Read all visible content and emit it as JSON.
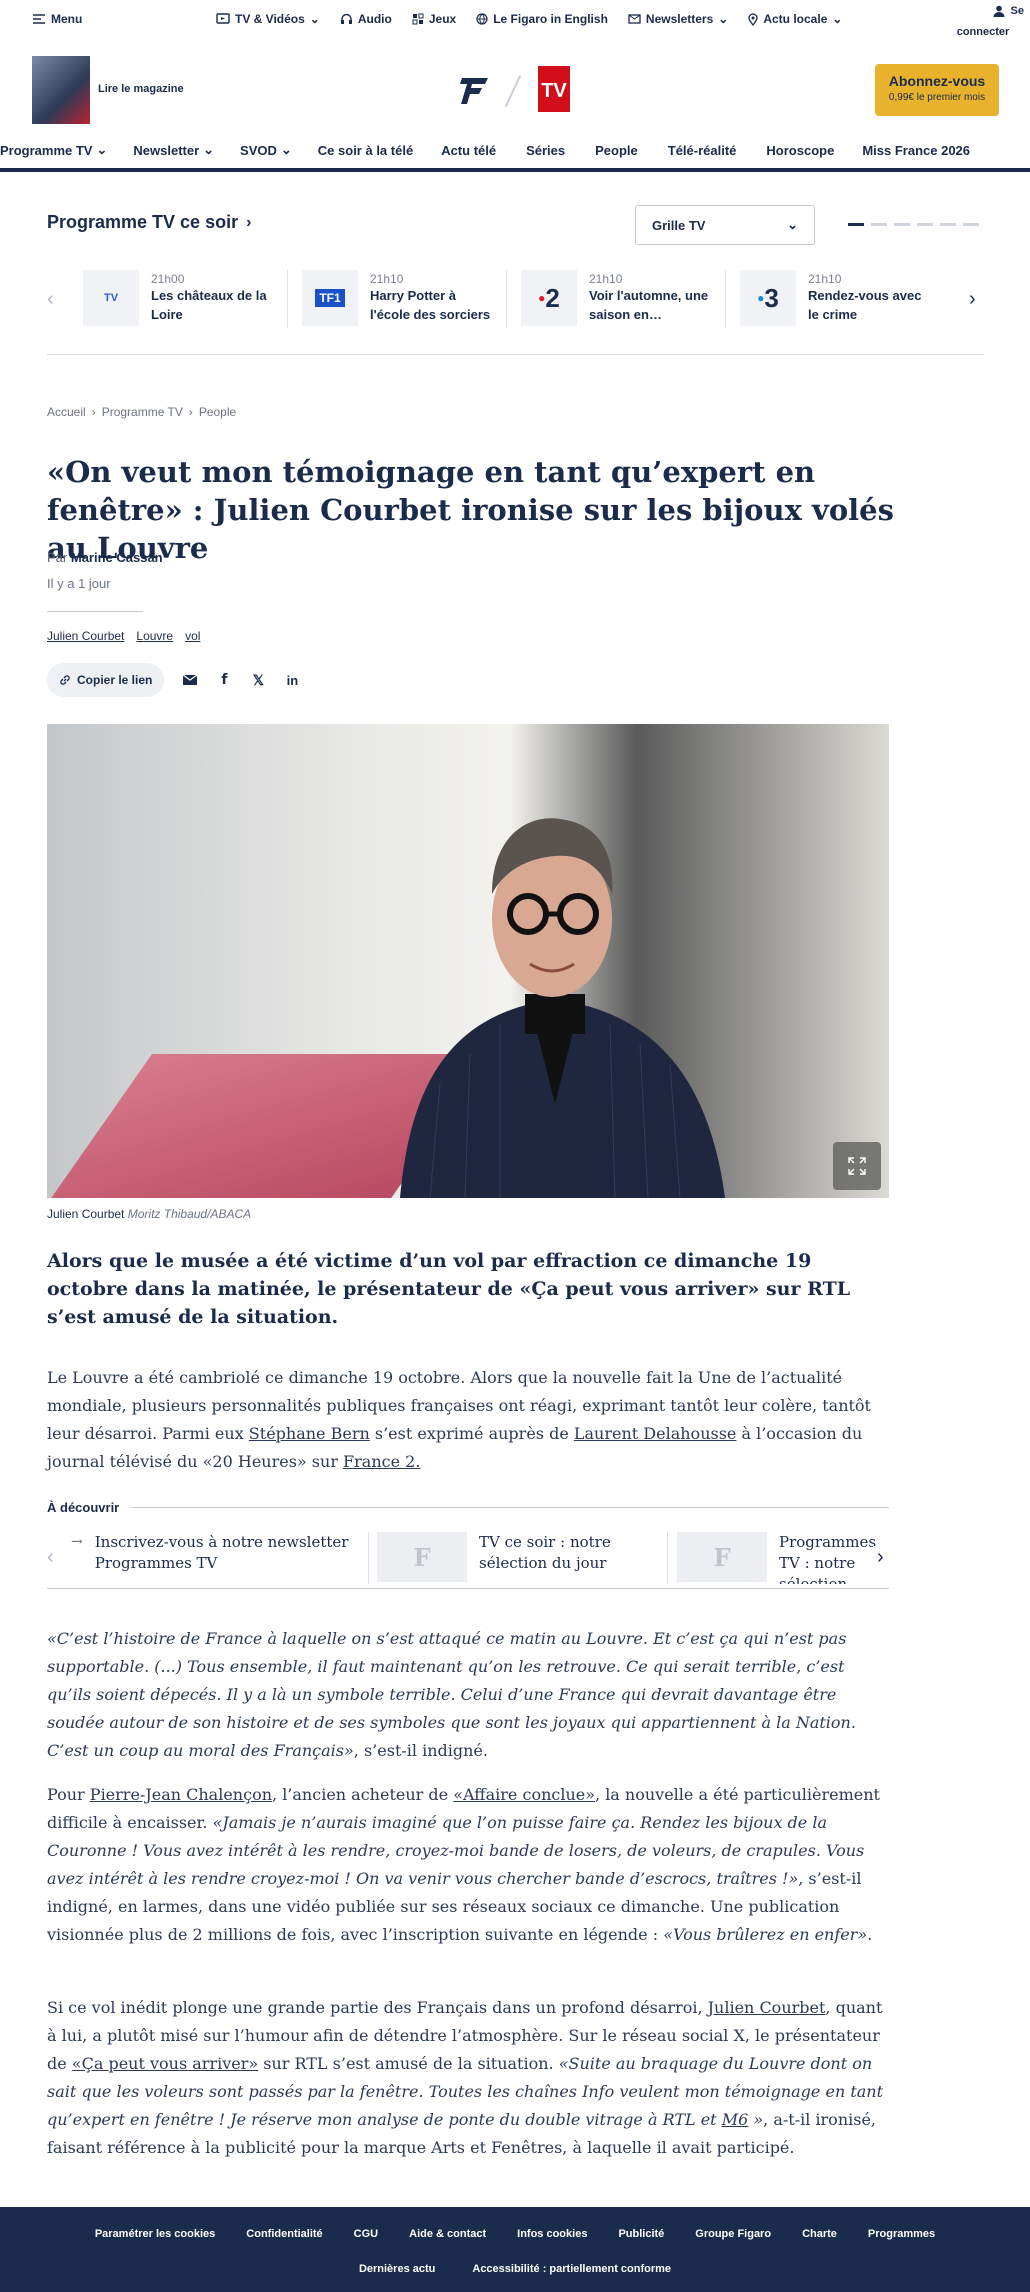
{
  "utility": {
    "menu": "Menu",
    "links": [
      "TV & Vidéos",
      "Audio",
      "Jeux",
      "Le Figaro in English",
      "Newsletters",
      "Actu locale"
    ],
    "login_line1": "Se",
    "login_line2": "connecter"
  },
  "header": {
    "magazine_label": "Lire le magazine",
    "subscribe_label": "Abonnez-vous",
    "subscribe_offer": "0,99€ le premier mois",
    "logo_tv_text": "TV"
  },
  "nav": [
    "Programme TV",
    "Newsletter",
    "SVOD",
    "Ce soir à la télé",
    "Actu télé",
    "Séries",
    "People",
    "Télé-réalité",
    "Horoscope",
    "Miss France 2026"
  ],
  "tonight": {
    "title": "Programme TV ce soir",
    "select_value": "Grille TV",
    "items": [
      {
        "channel": "TV",
        "time": "21h00",
        "name": "Les châteaux de la Loire"
      },
      {
        "channel": "TF1",
        "time": "21h10",
        "name": "Harry Potter à l'école des sorciers"
      },
      {
        "channel": "2",
        "time": "21h10",
        "name": "Voir l'automne, une saison en…"
      },
      {
        "channel": "3",
        "time": "21h10",
        "name": "Rendez-vous avec le crime"
      }
    ]
  },
  "breadcrumb": [
    "Accueil",
    "Programme TV",
    "People"
  ],
  "article": {
    "title": "«On veut mon témoignage en tant qu’expert en fenêtre» : Julien Courbet ironise sur les bijoux volés au Louvre",
    "by_prefix": "Par",
    "author": "Marine Cassan",
    "published": "Il y a 1 jour",
    "tags": [
      "Julien Courbet",
      "Louvre",
      "vol"
    ],
    "copy_link": "Copier le lien",
    "caption_name": "Julien Courbet",
    "caption_credit": "Moritz Thibaud/ABACA",
    "chapo": "Alors que le musée a été victime d’un vol par effraction ce dimanche 19 octobre dans la matinée, le présentateur de «Ça peut vous arriver» sur RTL s’est amusé de la situation.",
    "p1": {
      "a": "Le Louvre a été cambriolé ce dimanche 19 octobre. Alors que la nouvelle fait la Une de l’actualité mondiale, plusieurs personnalités publiques françaises ont réagi, exprimant tantôt leur colère, tantôt leur désarroi. Parmi eux ",
      "link1": "Stéphane Bern",
      "b": " s’est exprimé auprès de ",
      "link2": "Laurent Delahousse",
      "c": " à l’occasion du journal télévisé du «20 Heures» sur ",
      "link3": "France 2.",
      "d": ""
    },
    "p2": {
      "quote": "«C’est l’histoire de France à laquelle on s’est attaqué ce matin au Louvre. Et c’est ça qui n’est pas supportable. (...) Tous ensemble, il faut maintenant qu’on les retrouve. Ce qui serait terrible, c’est qu’ils soient dépecés. Il y a là un symbole terrible. Celui d’une France qui devrait davantage être soudée autour de son histoire et de ses symboles que sont les joyaux qui appartiennent à la Nation. C’est un coup au moral des Français»",
      "after": ", s’est-il indigné."
    },
    "p3": {
      "a": "Pour ",
      "link1": "Pierre-Jean Chalençon",
      "b": ", l’ancien acheteur de ",
      "link2": "«Affaire conclue»",
      "c": ", la nouvelle a été particulièrement difficile à encaisser. ",
      "quote": "«Jamais je n’aurais imaginé que l’on puisse faire ça. Rendez les bijoux de la Couronne ! Vous avez intérêt à les rendre, croyez-moi bande de losers, de voleurs, de crapules. Vous avez intérêt à les rendre croyez-moi ! On va venir vous chercher bande d’escrocs, traîtres !»",
      "d": ", s’est-il indigné, en larmes, dans une vidéo publiée sur ses réseaux sociaux ce dimanche. Une publication visionnée plus de 2 millions de fois, avec l’inscription suivante en légende : ",
      "quote2": "«Vous brûlerez en enfer»",
      "e": "."
    },
    "p4": {
      "a": "Si ce vol inédit plonge une grande partie des Français dans un profond désarroi, ",
      "link1": "Julien Courbet",
      "b": ", quant à lui, a plutôt misé sur l’humour afin de détendre l’atmosphère. Sur le réseau social X, le présentateur de ",
      "link2": "«Ça peut vous arriver»",
      "c": " sur RTL s’est amusé de la situation. ",
      "quote": "«Suite au braquage du Louvre dont on sait que les voleurs sont passés par la fenêtre. Toutes les chaînes Info veulent mon témoignage en tant qu’expert en fenêtre ! Je réserve mon analyse de ponte du double vitrage à RTL et ",
      "link3": "M6",
      "quote_end": " »",
      "d": ", a-t-il ironisé, faisant référence à la publicité pour la marque Arts et Fenêtres, à laquelle il avait participé."
    }
  },
  "discover": {
    "title": "À découvrir",
    "items": [
      "Inscrivez-vous à notre newsletter Programmes TV",
      "TV ce soir : notre sélection du jour",
      "Programmes TV : notre sélection"
    ]
  },
  "footer": {
    "row1": [
      "Paramétrer les cookies",
      "Confidentialité",
      "CGU",
      "Aide & contact",
      "Infos cookies",
      "Publicité",
      "Groupe Figaro",
      "Charte",
      "Programmes"
    ],
    "row2": [
      "Dernières actu",
      "Accessibilité : partiellement conforme"
    ]
  },
  "colors": {
    "navy": "#1b2b4b",
    "subscribe": "#e9b22c",
    "tv_red": "#d20e1a"
  }
}
